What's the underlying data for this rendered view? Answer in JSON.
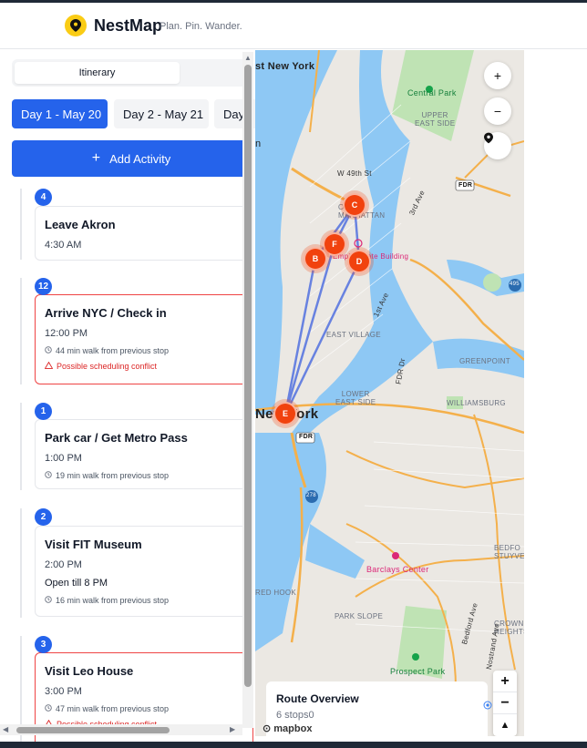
{
  "app": {
    "brand": "NestMap",
    "tagline": "Plan. Pin. Wander."
  },
  "tabs": {
    "itinerary": "Itinerary"
  },
  "days": [
    {
      "label": "Day 1 - May 20"
    },
    {
      "label": "Day 2 - May 21"
    },
    {
      "label": "Day"
    }
  ],
  "add_activity": "Add Activity",
  "activities": [
    {
      "number": "4",
      "title": "Leave Akron",
      "time": "4:30 AM"
    },
    {
      "number": "12",
      "title": "Arrive NYC / Check in",
      "time": "12:00 PM",
      "walk": "44 min walk from previous stop",
      "warning": "Possible scheduling conflict"
    },
    {
      "number": "1",
      "title": "Park car / Get Metro Pass",
      "time": "1:00 PM",
      "walk": "19 min walk from previous stop"
    },
    {
      "number": "2",
      "title": "Visit FIT Museum",
      "time": "2:00 PM",
      "hours": "Open till 8 PM",
      "walk": "16 min walk from previous stop"
    },
    {
      "number": "3",
      "title": "Visit Leo House",
      "time": "3:00 PM",
      "walk": "47 min walk from previous stop",
      "warning": "Possible scheduling conflict"
    }
  ],
  "map": {
    "labels": {
      "east_new_york": "st New York",
      "central_park": "Central Park",
      "upper_east_side": "UPPER\nEAST SIDE",
      "w49": "W 49th St",
      "midtown": "OWN\nMANHATTAN",
      "third_ave": "3rd Ave",
      "fdr": "FDR",
      "empire": "Empire State Building",
      "first_ave": "1st Ave",
      "east_village": "EAST VILLAGE",
      "fdr_dr": "FDR Dr",
      "greenpoint": "GREENPOINT",
      "lower_east_side": "LOWER\nEAST SIDE",
      "williamsburg": "WILLIAMSBURG",
      "new_york": "New York",
      "barclays": "Barclays Center",
      "bedford": "BEDFO\nSTUYVE",
      "red_hook": "RED HOOK",
      "park_slope": "PARK SLOPE",
      "crown": "CROWN\nHEIGHTS",
      "prospect": "Prospect Park",
      "bedford_ave": "Bedford Ave",
      "nostrand": "Nostrand Ave",
      "route_278": "278",
      "route_495": "495",
      "left_n": "n"
    },
    "markers": [
      "C",
      "F",
      "B",
      "D",
      "E"
    ],
    "route_overview": {
      "title": "Route Overview",
      "stops": "6 stops0"
    },
    "attribution": "mapbox",
    "zoom_in": "+",
    "zoom_out": "−",
    "compass": "▲"
  },
  "colors": {
    "accent": "#2563eb",
    "marker": "#f1420e",
    "conflict": "#ef4444",
    "water": "#8ec8f4",
    "park": "#bfe3b4",
    "route": "#5a78e0"
  }
}
